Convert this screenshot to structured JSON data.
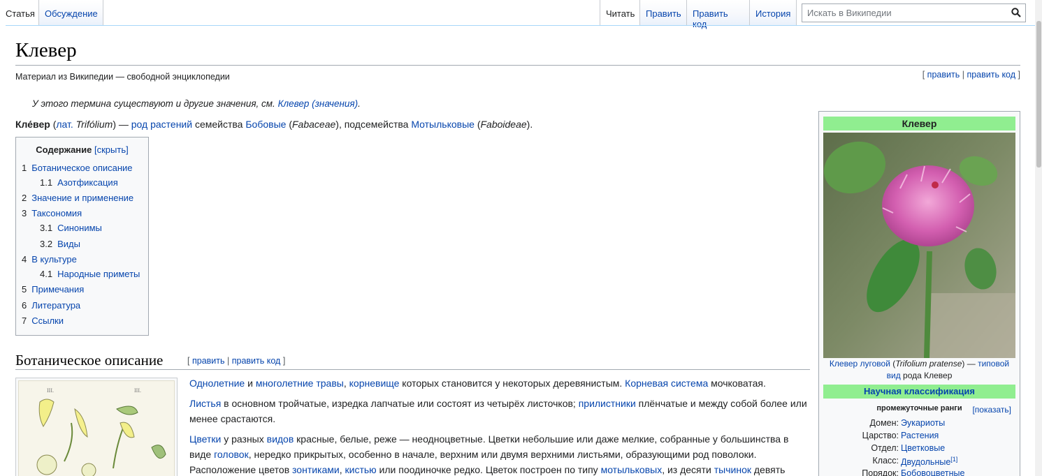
{
  "tabs_left": [
    "Статья",
    "Обсуждение"
  ],
  "tabs_right": [
    "Читать",
    "Править",
    "Править код",
    "История"
  ],
  "search": {
    "placeholder": "Искать в Википедии"
  },
  "title": "Клевер",
  "tagline": "Материал из Википедии — свободной энциклопедии",
  "edit_links": {
    "open": "[",
    "edit": "править",
    "sep": "|",
    "edit_code": "править код",
    "close": "]"
  },
  "hatnote": {
    "text": "У этого термина существуют и другие значения, см. ",
    "link": "Клевер (значения)",
    "end": "."
  },
  "lead": {
    "bold": "Кле́вер",
    "p1": " (",
    "lat": "лат.",
    "latin_name": " Trifólium",
    "p2": ") — ",
    "genus": "род растений",
    "p3": " семейства ",
    "family": "Бобовые",
    "p4": " (",
    "family_lat": "Fabaceae",
    "p5": "), подсемейства ",
    "subfamily": "Мотыльковые",
    "p6": " (",
    "subfamily_lat": "Faboideae",
    "p7": ")."
  },
  "toc": {
    "title": "Содержание",
    "hide": "[скрыть]",
    "items": [
      {
        "num": "1",
        "label": "Ботаническое описание"
      },
      {
        "num": "1.1",
        "label": "Азотфиксация"
      },
      {
        "num": "2",
        "label": "Значение и применение"
      },
      {
        "num": "3",
        "label": "Таксономия"
      },
      {
        "num": "3.1",
        "label": "Синонимы"
      },
      {
        "num": "3.2",
        "label": "Виды"
      },
      {
        "num": "4",
        "label": "В культуре"
      },
      {
        "num": "4.1",
        "label": "Народные приметы"
      },
      {
        "num": "5",
        "label": "Примечания"
      },
      {
        "num": "6",
        "label": "Литература"
      },
      {
        "num": "7",
        "label": "Ссылки"
      }
    ]
  },
  "section": {
    "title": "Ботаническое описание"
  },
  "paragraphs": {
    "p1": {
      "a": "Однолетние",
      "t1": " и ",
      "b": "многолетние травы",
      "t2": ", ",
      "c": "корневище",
      "t3": " которых становится у некоторых деревянистым. ",
      "d": "Корневая система",
      "t4": " мочковатая."
    },
    "p2": {
      "a": "Листья",
      "t1": " в основном тройчатые, изредка лапчатые или состоят из четырёх листочков; ",
      "b": "прилистники",
      "t2": " плёнчатые и между собой более или менее срастаются."
    },
    "p3": {
      "a": "Цветки",
      "t1": " у разных ",
      "b": "видов",
      "t2": " красные, белые, реже — неодноцветные. Цветки небольшие или даже мелкие, собранные у большинства в виде ",
      "c": "головок",
      "t3": ", нередко прикрытых, особенно в начале, верхним или двумя верхними листьями, образующими род поволоки. Расположение цветов ",
      "d": "зонтиками",
      "t4": ", ",
      "e": "кистью",
      "t5": " или поодиночке редко. Цветок построен по типу ",
      "f": "мотыльковых",
      "t6": ", из десяти ",
      "g": "тычинок",
      "t7": " девять"
    }
  },
  "infobox": {
    "title": "Клевер",
    "caption": {
      "a": "Клевер луговой",
      "t1": " (",
      "latin": "Trifolium pratense",
      "t2": ") — ",
      "b": "типовой вид",
      "t3": " рода Клевер"
    },
    "sci": "Научная классификация",
    "ranks": "промежуточные ранги",
    "show": "[показать]",
    "rows": [
      {
        "label": "Домен:",
        "value": "Эукариоты"
      },
      {
        "label": "Царство:",
        "value": "Растения"
      },
      {
        "label": "Отдел:",
        "value": "Цветковые"
      },
      {
        "label": "Класс:",
        "value": "Двудольные",
        "sup": "[1]"
      },
      {
        "label": "Порядок:",
        "value": "Бобовоцветные"
      }
    ]
  },
  "colors": {
    "link": "#0645ad",
    "infobox_header": "#90ee90",
    "border": "#a2a9b1"
  }
}
